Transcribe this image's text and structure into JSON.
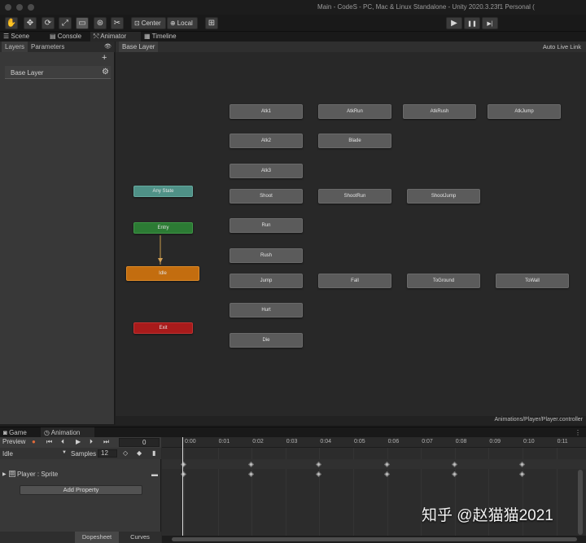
{
  "window": {
    "title": "Main - CodeS - PC, Mac & Linux Standalone - Unity 2020.3.23f1 Personal ("
  },
  "toolbar": {
    "tools": [
      {
        "icon": "hand-icon",
        "glyph": "✋"
      },
      {
        "icon": "move-icon",
        "glyph": "✥"
      },
      {
        "icon": "rotate-icon",
        "glyph": "⟳"
      },
      {
        "icon": "scale-icon",
        "glyph": "⤢"
      },
      {
        "icon": "rect-icon",
        "glyph": "▭"
      },
      {
        "icon": "transform-icon",
        "glyph": "⊛"
      },
      {
        "icon": "custom-tool-icon",
        "glyph": "✂"
      }
    ],
    "center_label": "Center",
    "local_label": "Local",
    "grid_icon_glyph": "⊞",
    "play_glyph": "▶",
    "pause_glyph": "❚❚",
    "step_glyph": "▶|"
  },
  "tabs": {
    "scene": "Scene",
    "console": "Console",
    "animator": "Animator",
    "timeline": "Timeline"
  },
  "layers_panel": {
    "tab_layers": "Layers",
    "tab_parameters": "Parameters",
    "add_glyph": "+",
    "layer_name": "Base Layer",
    "eye_glyph": "👁",
    "gear_glyph": "⚙"
  },
  "graph": {
    "breadcrumb": "Base Layer",
    "auto_live_link": "Auto Live Link",
    "controller_path": "Animations/Player/Player.controller",
    "states": [
      {
        "name": "Atk1",
        "kind": "normal"
      },
      {
        "name": "AtkRun",
        "kind": "normal"
      },
      {
        "name": "AtkRush",
        "kind": "normal"
      },
      {
        "name": "AtkJump",
        "kind": "normal"
      },
      {
        "name": "Atk2",
        "kind": "normal"
      },
      {
        "name": "Blade",
        "kind": "normal"
      },
      {
        "name": "Atk3",
        "kind": "normal"
      },
      {
        "name": "Any State",
        "kind": "any"
      },
      {
        "name": "Shoot",
        "kind": "normal"
      },
      {
        "name": "ShootRun",
        "kind": "normal"
      },
      {
        "name": "ShootJump",
        "kind": "normal"
      },
      {
        "name": "Entry",
        "kind": "entry"
      },
      {
        "name": "Run",
        "kind": "normal"
      },
      {
        "name": "Rush",
        "kind": "normal"
      },
      {
        "name": "Idle",
        "kind": "default"
      },
      {
        "name": "Jump",
        "kind": "normal"
      },
      {
        "name": "Fall",
        "kind": "normal"
      },
      {
        "name": "ToGround",
        "kind": "normal"
      },
      {
        "name": "ToWall",
        "kind": "normal"
      },
      {
        "name": "Hurt",
        "kind": "normal"
      },
      {
        "name": "Exit",
        "kind": "exit"
      },
      {
        "name": "Die",
        "kind": "normal"
      }
    ]
  },
  "bottom_tabs": {
    "game": "Game",
    "animation": "Animation"
  },
  "animation": {
    "preview_label": "Preview",
    "record_glyph": "●",
    "first_glyph": "⏮",
    "prev_glyph": "⏴",
    "play_glyph": "▶",
    "next_glyph": "⏵",
    "last_glyph": "⏭",
    "frame_value": "0",
    "clip_name": "Idle",
    "samples_label": "Samples",
    "samples_value": "12",
    "property_name": "Player : Sprite",
    "add_property_label": "Add Property",
    "tab_dopesheet": "Dopesheet",
    "tab_curves": "Curves",
    "ruler_labels": [
      "0:00",
      "0:01",
      "0:02",
      "0:03",
      "0:04",
      "0:05",
      "0:06",
      "0:07",
      "0:08",
      "0:09",
      "0:10",
      "0:11"
    ],
    "keyframe_frames": [
      0,
      2,
      4,
      6,
      8,
      10
    ]
  },
  "watermark": {
    "text": "知乎 @赵猫猫2021"
  }
}
